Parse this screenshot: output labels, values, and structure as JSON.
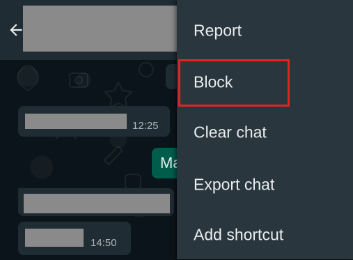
{
  "header": {
    "back_icon": "arrow-left-icon"
  },
  "messages": [
    {
      "direction": "in",
      "time": "12:25"
    },
    {
      "direction": "out",
      "text": "Ma"
    },
    {
      "direction": "in",
      "time": ""
    },
    {
      "direction": "in",
      "time": "14:50"
    }
  ],
  "menu": {
    "items": [
      {
        "label": "Report"
      },
      {
        "label": "Block"
      },
      {
        "label": "Clear chat"
      },
      {
        "label": "Export chat"
      },
      {
        "label": "Add shortcut"
      }
    ]
  },
  "colors": {
    "header_bg": "#1f2c34",
    "menu_bg": "#2a363d",
    "bubble_in": "#202c33",
    "bubble_out": "#005c4b",
    "highlight": "#e02424"
  }
}
